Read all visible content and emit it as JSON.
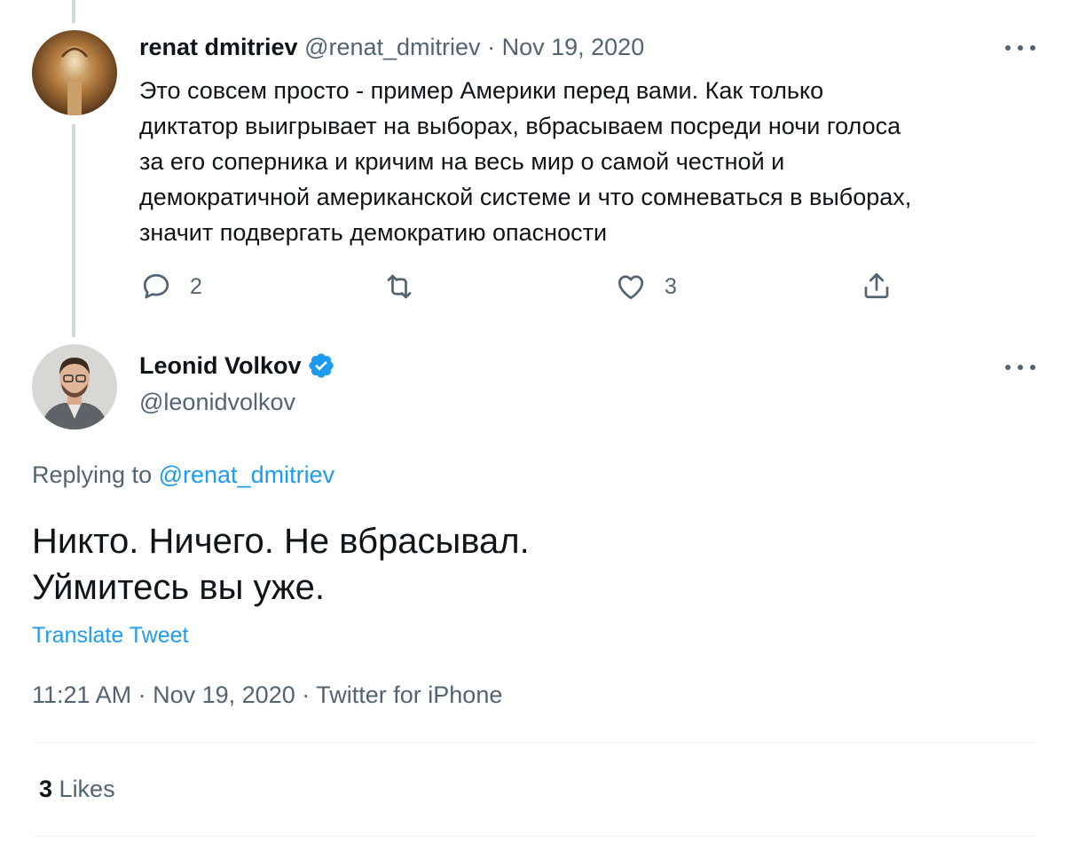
{
  "parent_tweet": {
    "author_name": "renat dmitriev",
    "author_handle": "@renat_dmitriev",
    "separator": "·",
    "date": "Nov 19, 2020",
    "text_lines": [
      "Это совсем просто - пример Америки перед вами. Как только",
      "диктатор выигрывает на выборах, вбрасываем посреди ночи  голоса",
      "за его соперника и кричим на весь мир о самой честной и",
      "демократичной американской системе и что сомневаться в выборах,",
      "значит подвергать демократию опасности"
    ],
    "reply_count": "2",
    "like_count": "3",
    "more_icon": "more-dots-icon",
    "reply_icon": "reply-bubble-icon",
    "retweet_icon": "retweet-icon",
    "like_icon": "heart-icon",
    "share_icon": "share-icon"
  },
  "main_tweet": {
    "author_name": "Leonid Volkov",
    "author_handle": "@leonidvolkov",
    "verified_icon": "verified-badge-icon",
    "replying_label": "Replying to",
    "replying_handle": "@renat_dmitriev",
    "text_lines": [
      "Никто. Ничего. Не вбрасывал.",
      "Уймитесь вы уже."
    ],
    "translate_label": "Translate Tweet",
    "time": "11:21 AM",
    "separator": "·",
    "date": "Nov 19, 2020",
    "source": "Twitter for iPhone",
    "likes_count": "3",
    "likes_label": "Likes"
  },
  "colors": {
    "accent": "#1d9bf0",
    "muted": "#536471",
    "text": "#0f1419",
    "thread_line": "#cfd9de",
    "divider": "#eff3f4"
  }
}
